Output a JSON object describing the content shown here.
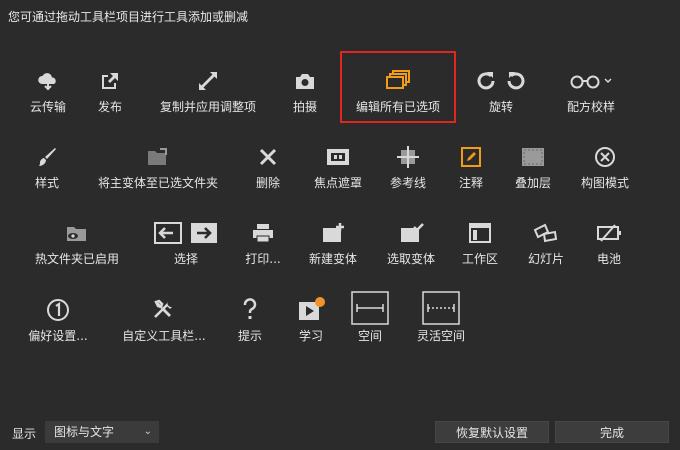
{
  "header": {
    "text": "您可通过拖动工具栏项目进行工具添加或删减"
  },
  "tools": {
    "cloud_transfer": {
      "label": "云传输",
      "icon": "cloud-download-icon"
    },
    "publish": {
      "label": "发布",
      "icon": "share-icon"
    },
    "copy_apply": {
      "label": "复制并应用调整项",
      "icon": "expand-arrow-icon"
    },
    "capture": {
      "label": "拍摄",
      "icon": "camera-icon"
    },
    "edit_all_selected": {
      "label": "编辑所有已选项",
      "icon": "stacked-windows-icon"
    },
    "rotate": {
      "label": "旋转",
      "icon": "rotate-icon"
    },
    "recipe_proof": {
      "label": "配方校样",
      "icon": "glasses-icon"
    },
    "styles": {
      "label": "样式",
      "icon": "brush-icon"
    },
    "move_variant": {
      "label": "将主变体至已选文件夹",
      "icon": "folder-move-icon"
    },
    "delete": {
      "label": "删除",
      "icon": "x-icon"
    },
    "focus_mask": {
      "label": "焦点遮罩",
      "icon": "focus-mask-icon"
    },
    "guides": {
      "label": "参考线",
      "icon": "guides-icon"
    },
    "annotations": {
      "label": "注释",
      "icon": "pencil-square-icon"
    },
    "overlay": {
      "label": "叠加层",
      "icon": "overlay-icon"
    },
    "composition_mode": {
      "label": "构图模式",
      "icon": "circle-x-icon"
    },
    "hot_folder": {
      "label": "热文件夹已启用",
      "icon": "eye-folder-icon"
    },
    "select": {
      "label": "选择",
      "icon": "select-arrows-icon"
    },
    "print": {
      "label": "打印...",
      "icon": "printer-icon"
    },
    "new_variant": {
      "label": "新建变体",
      "icon": "new-variant-icon"
    },
    "pick_variant": {
      "label": "选取变体",
      "icon": "pick-variant-icon"
    },
    "workspace": {
      "label": "工作区",
      "icon": "workspace-icon"
    },
    "slideshow": {
      "label": "幻灯片",
      "icon": "slides-icon"
    },
    "battery": {
      "label": "电池",
      "icon": "battery-icon"
    },
    "preferences": {
      "label": "偏好设置...",
      "icon": "number-one-icon"
    },
    "customize_toolbar": {
      "label": "自定义工具栏...",
      "icon": "tools-icon"
    },
    "tips": {
      "label": "提示",
      "icon": "question-icon"
    },
    "learn": {
      "label": "学习",
      "icon": "play-badge-icon"
    },
    "space": {
      "label": "空间",
      "icon": "space-icon"
    },
    "flexible_space": {
      "label": "灵活空间",
      "icon": "flexible-space-icon"
    }
  },
  "footer": {
    "show_label": "显示",
    "display_select": {
      "value": "图标与文字"
    },
    "restore_defaults": "恢复默认设置",
    "done": "完成"
  },
  "colors": {
    "background": "#2b2b2b",
    "icon": "#d9d9d9",
    "accent": "#f39a1b",
    "selection": "#e0261f",
    "badge": "#f0942a"
  }
}
